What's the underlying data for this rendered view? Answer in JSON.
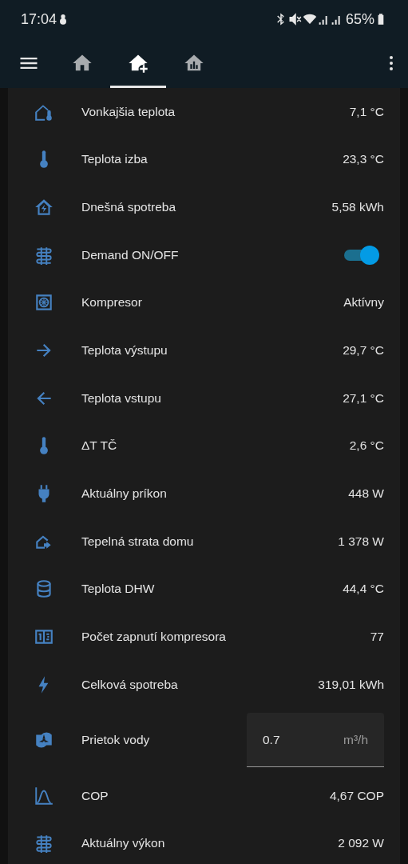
{
  "status_bar": {
    "time": "17:04",
    "battery": "65%"
  },
  "toolbar": {
    "tabs": [
      {
        "selected": false
      },
      {
        "selected": true
      },
      {
        "selected": false
      }
    ]
  },
  "rows": [
    {
      "kind": "value",
      "name": "Vonkajšia teplota",
      "value": "7,1 °C"
    },
    {
      "kind": "value",
      "name": "Teplota izba",
      "value": "23,3 °C"
    },
    {
      "kind": "value",
      "name": "Dnešná spotreba",
      "value": "5,58 kWh"
    },
    {
      "kind": "toggle",
      "name": "Demand ON/OFF",
      "on": true
    },
    {
      "kind": "value",
      "name": "Kompresor",
      "value": "Aktívny"
    },
    {
      "kind": "value",
      "name": "Teplota výstupu",
      "value": "29,7 °C"
    },
    {
      "kind": "value",
      "name": "Teplota vstupu",
      "value": "27,1 °C"
    },
    {
      "kind": "value",
      "name": "ΔT TČ",
      "value": "2,6 °C"
    },
    {
      "kind": "value",
      "name": "Aktuálny príkon",
      "value": "448 W"
    },
    {
      "kind": "value",
      "name": "Tepelná strata domu",
      "value": "1 378 W"
    },
    {
      "kind": "value",
      "name": "Teplota DHW",
      "value": "44,4 °C"
    },
    {
      "kind": "value",
      "name": "Počet zapnutí kompresora",
      "value": "77"
    },
    {
      "kind": "value",
      "name": "Celková spotreba",
      "value": "319,01 kWh"
    },
    {
      "kind": "input",
      "name": "Prietok vody",
      "value": "0.7",
      "unit": "m³/h"
    },
    {
      "kind": "value",
      "name": "COP",
      "value": "4,67 COP"
    },
    {
      "kind": "value",
      "name": "Aktuálny výkon",
      "value": "2 092 W"
    }
  ]
}
